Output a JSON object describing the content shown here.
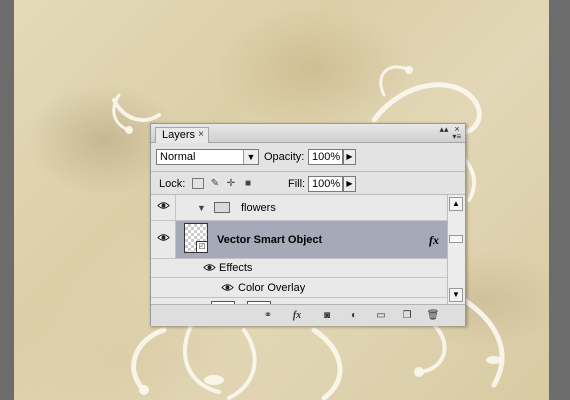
{
  "panel": {
    "tab_label": "Layers",
    "tab_close": "×",
    "collapse_glyph": "▴▴",
    "close_glyph": "×",
    "menu_glyph": "▾≡",
    "blend_mode": "Normal",
    "opacity_label": "Opacity:",
    "opacity_value": "100%",
    "lock_label": "Lock:",
    "fill_label": "Fill:",
    "fill_value": "100%",
    "layers": {
      "group_name": "flowers",
      "smart_object_name": "Vector Smart Object",
      "fx_badge": "fx",
      "effects_label": "Effects",
      "color_overlay_label": "Color Overlay"
    },
    "bottom_fx": "fx"
  },
  "icons": [
    "eye-icon",
    "folder-icon",
    "link-icon",
    "fx-icon",
    "mask-icon",
    "adjustment-icon",
    "new-group-icon",
    "new-layer-icon",
    "trash-icon"
  ]
}
